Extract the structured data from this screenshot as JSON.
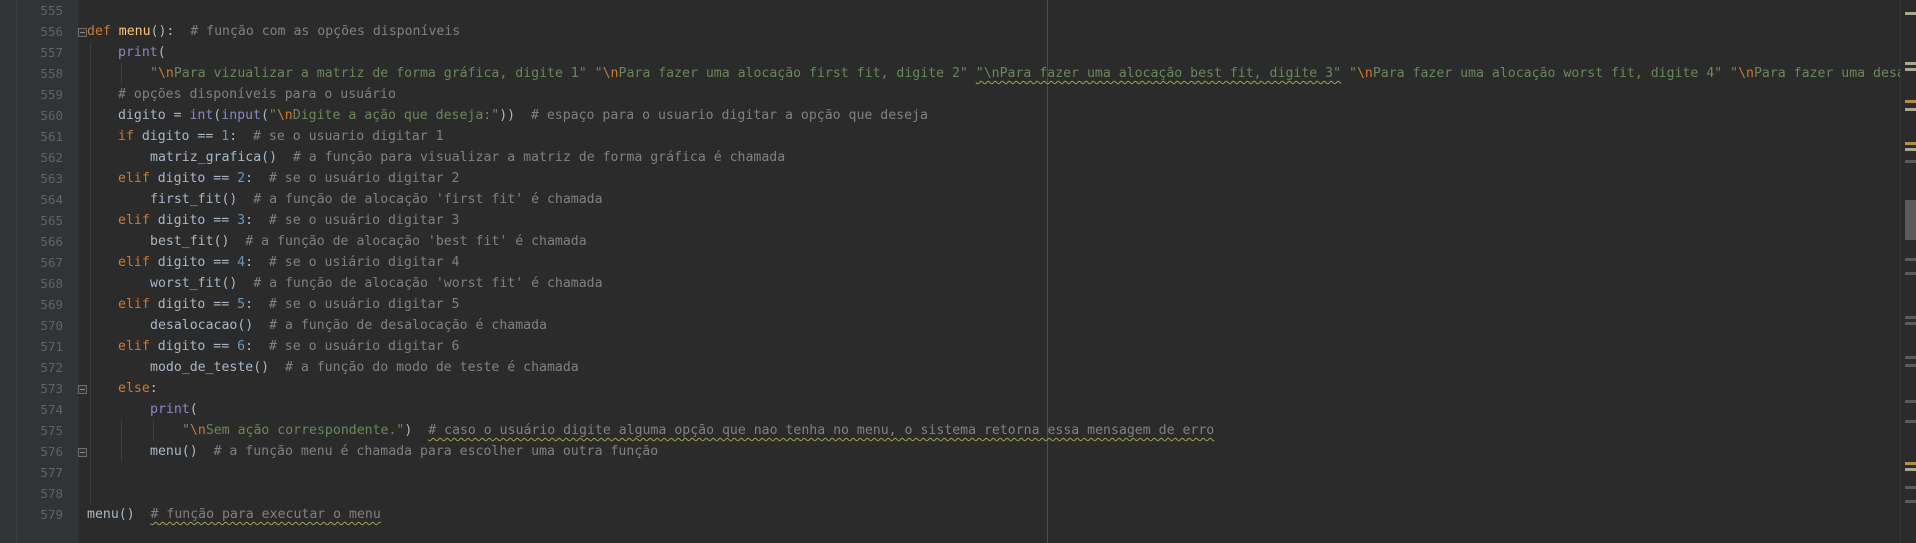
{
  "editor": {
    "line_numbers": [
      "555",
      "556",
      "557",
      "558",
      "559",
      "560",
      "561",
      "562",
      "563",
      "564",
      "565",
      "566",
      "567",
      "568",
      "569",
      "570",
      "571",
      "572",
      "573",
      "574",
      "575",
      "576",
      "577",
      "578",
      "579"
    ],
    "tokens": {
      "l556": [
        "def",
        "menu",
        "():",
        "  # função com as opções disponíveis"
      ],
      "l557": [
        "print",
        "("
      ],
      "l558": [
        "\"",
        "\\n",
        "Para vizualizar a matriz de forma gráfica, digite 1\"",
        " ",
        "\"",
        "\\n",
        "Para fazer uma alocação first fit, digite 2\"",
        " ",
        "\"\\nPara fazer uma alocação best fit, digite 3\"",
        " ",
        "\"",
        "\\n",
        "Para fazer uma alocação worst fit, digite 4\"",
        " ",
        "\"",
        "\\n",
        "Para fazer uma desa"
      ],
      "l559": [
        "# opções disponíveis para o usuário"
      ],
      "l560": [
        "digito = ",
        "int",
        "(",
        "input",
        "(",
        "\"",
        "\\n",
        "Digite a ação que deseja:\"",
        "))",
        "  # espaço para o usuario digitar a opção que deseja"
      ],
      "l561": [
        "if",
        " digito == ",
        "1",
        ":",
        "  # se o usuario digitar 1"
      ],
      "l562": [
        "matriz_grafica()",
        "  # a função para visualizar a matriz de forma gráfica é chamada"
      ],
      "l563": [
        "elif",
        " digito == ",
        "2",
        ":",
        "  # se o usuário digitar 2"
      ],
      "l564": [
        "first_fit()",
        "  # a função de alocação 'first fit' é chamada"
      ],
      "l565": [
        "elif",
        " digito == ",
        "3",
        ":",
        "  # se o usuário digitar 3"
      ],
      "l566": [
        "best_fit()",
        "  # a função de alocação 'best fit' é chamada"
      ],
      "l567": [
        "elif",
        " digito == ",
        "4",
        ":",
        "  # se o usiário digitar 4"
      ],
      "l568": [
        "worst_fit()",
        "  # a função de alocação 'worst fit' é chamada"
      ],
      "l569": [
        "elif",
        " digito == ",
        "5",
        ":",
        "  # se o usuário digitar 5"
      ],
      "l570": [
        "desalocacao()",
        "  # a função de desalocação é chamada"
      ],
      "l571": [
        "elif",
        " digito == ",
        "6",
        ":",
        "  # se o usuário digitar 6"
      ],
      "l572": [
        "modo_de_teste()",
        "  # a função do modo de teste é chamada"
      ],
      "l573": [
        "else",
        ":"
      ],
      "l574": [
        "print",
        "("
      ],
      "l575": [
        "\"",
        "\\n",
        "Sem ação correspondente.\"",
        ")",
        "  ",
        "# caso o usuário digite alguma opção que nao tenha no menu, o sistema retorna essa mensagem de erro"
      ],
      "l576": [
        "menu()",
        "  # a função menu é chamada para escolher uma outra função"
      ],
      "l579": [
        "menu()",
        "  ",
        "# função para executar o menu"
      ]
    },
    "colors": {
      "background": "#2b2b2b",
      "gutter": "#313335",
      "keyword": "#cc7832",
      "function_def": "#ffc66d",
      "builtin": "#8888c6",
      "number": "#6897bb",
      "string": "#6a8759",
      "comment": "#808080",
      "default_text": "#a9b7c6",
      "line_number": "#606366"
    }
  }
}
